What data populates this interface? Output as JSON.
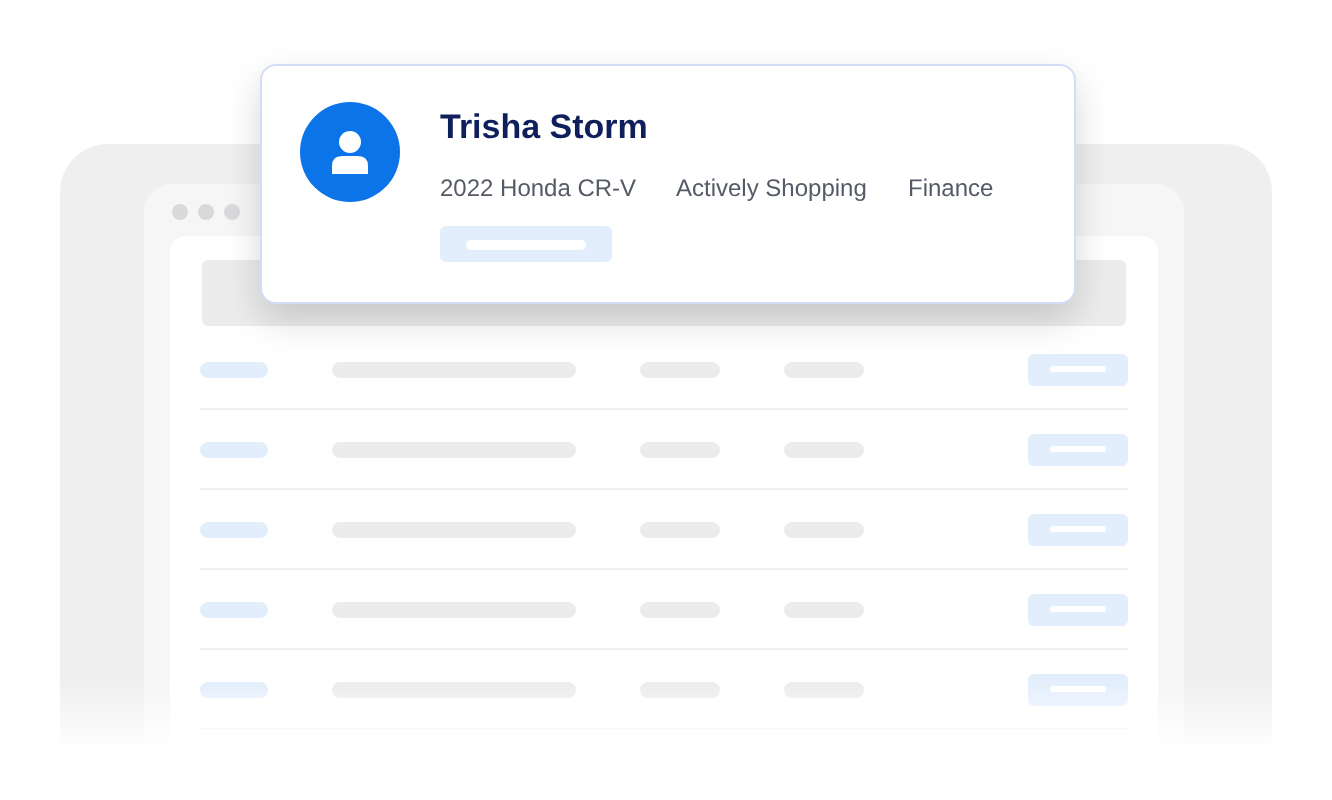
{
  "contact_card": {
    "name": "Trisha Storm",
    "details": [
      "2022 Honda CR-V",
      "Actively Shopping",
      "Finance"
    ]
  }
}
